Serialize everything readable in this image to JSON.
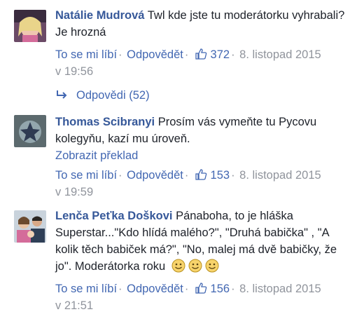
{
  "comments": [
    {
      "author": "Natálie Mudrová",
      "text": "Twl kde jste tu moderátorku vyhrabali? Je hrozná",
      "like_label": "To se mi líbí",
      "reply_label": "Odpovědět",
      "likes": "372",
      "date": "8. listopad 2015",
      "time": "v 19:56"
    },
    {
      "author": "Thomas Scibranyi",
      "text": "Prosím vás vymeňte tu Pycovu kolegyňu, kazí mu úroveň.",
      "translate": "Zobrazit překlad",
      "like_label": "To se mi líbí",
      "reply_label": "Odpovědět",
      "likes": "153",
      "date": "8. listopad 2015",
      "time": "v 19:59"
    },
    {
      "author": "Lenča Peťka Doškovi",
      "text": "Pánaboha, to je hláška Superstar...\"Kdo hlídá malého?\", \"Druhá babička\" , \"A kolik těch babiček má?\", \"No, malej má dvě babičky, že jo\". Moderátorka roku",
      "like_label": "To se mi líbí",
      "reply_label": "Odpovědět",
      "likes": "156",
      "date": "8. listopad 2015",
      "time": "v 21:51"
    }
  ],
  "replies": {
    "label": "Odpovědi (52)"
  },
  "colors": {
    "author": "#365899",
    "link": "#4267b2",
    "meta": "#90949c"
  },
  "icons": [
    "thumbs-up-icon",
    "reply-arrow-icon",
    "smiley-icon"
  ]
}
